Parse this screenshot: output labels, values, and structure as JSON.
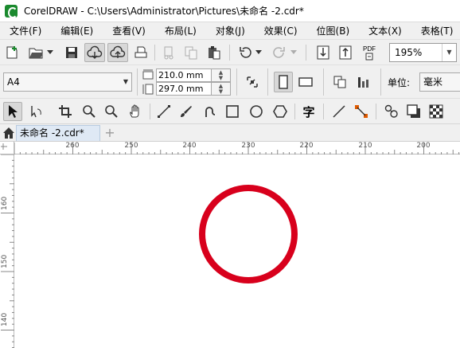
{
  "window": {
    "title": "CorelDRAW - C:\\Users\\Administrator\\Pictures\\未命名 -2.cdr*"
  },
  "menu": {
    "items": [
      {
        "label": "文件(F)"
      },
      {
        "label": "编辑(E)"
      },
      {
        "label": "查看(V)"
      },
      {
        "label": "布局(L)"
      },
      {
        "label": "对象(J)"
      },
      {
        "label": "效果(C)"
      },
      {
        "label": "位图(B)"
      },
      {
        "label": "文本(X)"
      },
      {
        "label": "表格(T)"
      }
    ]
  },
  "standard_toolbar": {
    "pdf_label": "PDF",
    "zoom_value": "195%"
  },
  "property_bar": {
    "paper_size": "A4",
    "width": "210.0 mm",
    "height": "297.0 mm",
    "units_label": "单位:",
    "units_value": "毫米"
  },
  "toolbox": {
    "text_tool_glyph": "字"
  },
  "document_tabs": {
    "active_tab": "未命名 -2.cdr*",
    "add_tab_glyph": "+"
  },
  "rulers": {
    "horizontal_labels": [
      "260",
      "250",
      "240",
      "230",
      "220",
      "210",
      "200"
    ],
    "vertical_labels": [
      "160",
      "150",
      "140"
    ]
  },
  "canvas": {
    "shape": "circle",
    "stroke_color": "#d8001c",
    "fill_color": "none"
  },
  "colors": {
    "ui_background": "#f0f0f0",
    "active_tab": "#dfe9f5",
    "app_icon": "#1b8a2e"
  }
}
